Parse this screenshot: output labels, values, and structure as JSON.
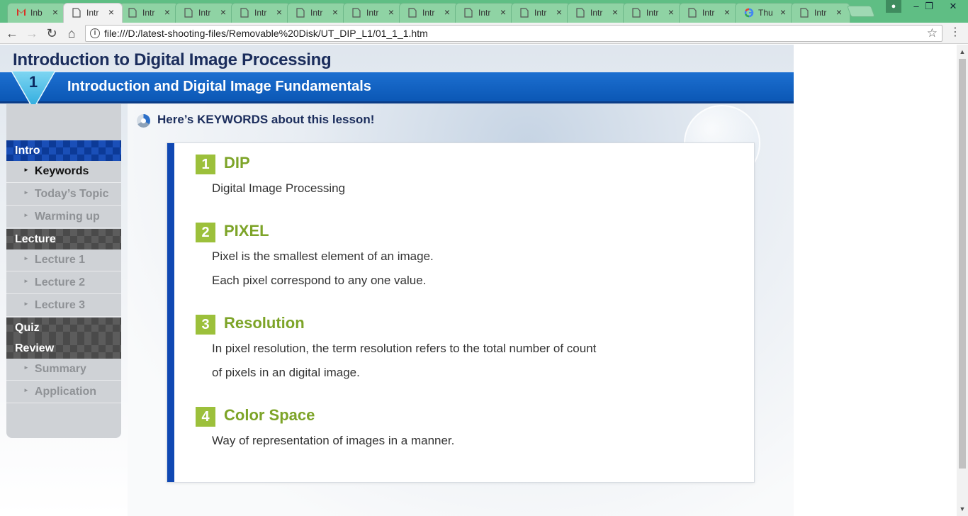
{
  "browser": {
    "tabs": [
      {
        "label": "Inb",
        "icon": "gmail-icon"
      },
      {
        "label": "Intr",
        "icon": "page-icon",
        "active": true
      },
      {
        "label": "Intr",
        "icon": "page-icon"
      },
      {
        "label": "Intr",
        "icon": "page-icon"
      },
      {
        "label": "Intr",
        "icon": "page-icon"
      },
      {
        "label": "Intr",
        "icon": "page-icon"
      },
      {
        "label": "Intr",
        "icon": "page-icon"
      },
      {
        "label": "Intr",
        "icon": "page-icon"
      },
      {
        "label": "Intr",
        "icon": "page-icon"
      },
      {
        "label": "Intr",
        "icon": "page-icon"
      },
      {
        "label": "Intr",
        "icon": "page-icon"
      },
      {
        "label": "Intr",
        "icon": "page-icon"
      },
      {
        "label": "Intr",
        "icon": "page-icon"
      },
      {
        "label": "Thu",
        "icon": "google-icon"
      },
      {
        "label": "Intr",
        "icon": "page-icon"
      }
    ],
    "url": "file:///D:/latest-shooting-files/Removable%20Disk/UT_DIP_L1/01_1_1.htm",
    "colors": {
      "tabstrip": "#5fbe84",
      "accent": "#1048b3"
    }
  },
  "lesson": {
    "course_title": "Introduction to Digital Image Processing",
    "chapter_number": "1",
    "chapter_title": "Introduction and Digital Image Fundamentals",
    "keywords_heading": "Here’s KEYWORDS about this lesson!"
  },
  "sidebar": {
    "sections": [
      {
        "title": "Intro",
        "items": [
          "Keywords",
          "Today’s Topic",
          "Warming up"
        ]
      },
      {
        "title": "Lecture",
        "items": [
          "Lecture 1",
          "Lecture 2",
          "Lecture 3"
        ]
      },
      {
        "title": "Quiz",
        "items": []
      },
      {
        "title": "Review",
        "items": [
          "Summary",
          "Application"
        ]
      }
    ],
    "current_item": "Keywords"
  },
  "keywords": [
    {
      "num": "1",
      "name": "DIP",
      "lines": [
        "Digital Image Processing"
      ]
    },
    {
      "num": "2",
      "name": "PIXEL",
      "lines": [
        "Pixel is the smallest element of an image.",
        "Each pixel correspond to any one value."
      ]
    },
    {
      "num": "3",
      "name": "Resolution",
      "lines": [
        "In pixel resolution, the term resolution refers to the total number of count",
        "of pixels in an digital image."
      ]
    },
    {
      "num": "4",
      "name": "Color Space",
      "lines": [
        "Way of representation of images in a manner."
      ]
    }
  ]
}
